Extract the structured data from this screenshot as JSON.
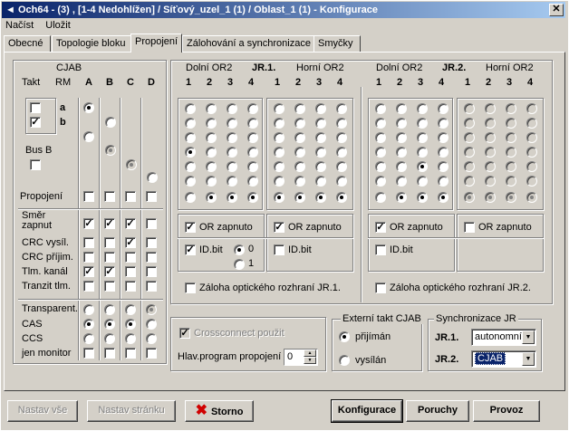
{
  "window": {
    "title": "◄ Och64 - (3) , [1-4 Nedohlížen] / Síťový_uzel_1 (1) / Oblast_1 (1) - Konfigurace",
    "close": "✕"
  },
  "menu": [
    "Načíst",
    "Uložit"
  ],
  "tabs": [
    "Obecné",
    "Topologie bloku",
    "Propojení",
    "Zálohování a synchronizace",
    "Smyčky"
  ],
  "cjab": {
    "header": "CJAB",
    "takt": "Takt",
    "rm": "RM",
    "cols": [
      "A",
      "B",
      "C",
      "D"
    ],
    "a": "a",
    "b": "b",
    "busb": "Bus B",
    "propojeni": "Propojení",
    "rows": [
      "Směr",
      "zapnut",
      "CRC vysíl.",
      "CRC příjim.",
      "Tlm. kanál",
      "Tranzit tlm.",
      "Transparent.",
      "CAS",
      "CCS",
      "jen monitor"
    ]
  },
  "jr1": {
    "title": "JR.1.",
    "dolni": "Dolní OR2",
    "horni": "Horní OR2",
    "nums": [
      "1",
      "2",
      "3",
      "4",
      "1",
      "2",
      "3",
      "4"
    ],
    "or_on": "OR zapnuto",
    "idbit": "ID.bit",
    "r0": "0",
    "r1": "1",
    "zaloha": "Záloha optického rozhraní JR.1."
  },
  "jr2": {
    "title": "JR.2.",
    "dolni": "Dolní OR2",
    "horni": "Horní OR2",
    "nums": [
      "1",
      "2",
      "3",
      "4",
      "1",
      "2",
      "3",
      "4"
    ],
    "or_on": "OR zapnuto",
    "idbit": "ID.bit",
    "zaloha": "Záloha optického rozhraní JR.2."
  },
  "cross": {
    "label": "Crossconnect použit",
    "hlav": "Hlav.program propojení",
    "value": "0"
  },
  "ext": {
    "title": "Externí takt CJAB",
    "prijiman": "přijímán",
    "vysilan": "vysílán"
  },
  "sync": {
    "title": "Synchronizace  JR",
    "jr1": "JR.1.",
    "jr1_val": "autonomní",
    "jr2": "JR.2.",
    "jr2_val": "CJAB"
  },
  "buttons": {
    "nastav_vse": "Nastav vše",
    "nastav_str": "Nastav stránku",
    "storno": "Storno",
    "konf": "Konfigurace",
    "poruchy": "Poruchy",
    "provoz": "Provoz"
  },
  "icons": {
    "storno": "red-x-icon"
  }
}
